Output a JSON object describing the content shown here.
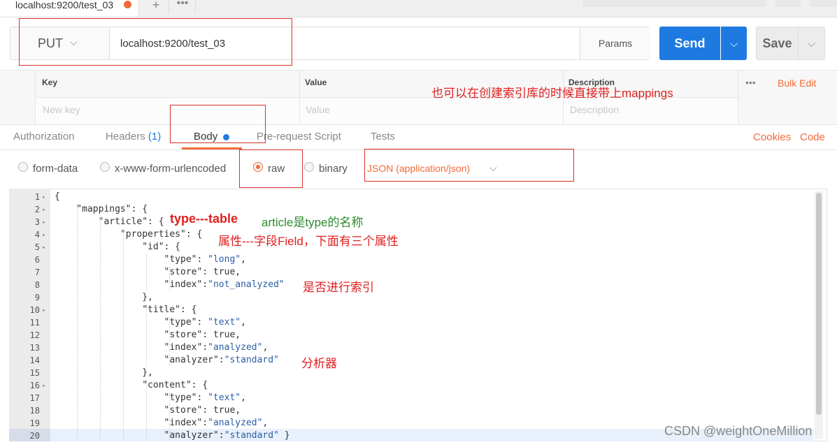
{
  "tabs": {
    "active_title": "localhost:9200/test_03",
    "new_tab": "+",
    "more": "•••"
  },
  "request": {
    "method": "PUT",
    "method_chevron": "⌵",
    "url": "localhost:9200/test_03",
    "params_label": "Params",
    "send_label": "Send",
    "save_label": "Save",
    "dropdown_arrow": "⌵"
  },
  "params_table": {
    "headers": [
      "Key",
      "Value",
      "Description"
    ],
    "placeholders": [
      "New key",
      "Value",
      "Description"
    ],
    "more": "•••",
    "bulk_edit": "Bulk Edit"
  },
  "sub_tabs": {
    "authorization": "Authorization",
    "headers": "Headers",
    "headers_count": "(1)",
    "body": "Body",
    "pre_request": "Pre-request Script",
    "tests": "Tests",
    "cookies": "Cookies",
    "code": "Code"
  },
  "body_types": {
    "options": [
      "form-data",
      "x-www-form-urlencoded",
      "raw",
      "binary"
    ],
    "selected": "raw",
    "content_type": "JSON (application/json)",
    "content_type_chevron": "⌵"
  },
  "editor": {
    "line_numbers": [
      "1",
      "2",
      "3",
      "4",
      "5",
      "6",
      "7",
      "8",
      "9",
      "10",
      "11",
      "12",
      "13",
      "14",
      "15",
      "16",
      "17",
      "18",
      "19",
      "20"
    ],
    "lines": [
      "{",
      "    \"mappings\": {",
      "        \"article\": {",
      "            \"properties\": {",
      "                \"id\": {",
      "                    \"type\": \"long\",",
      "                    \"store\": true,",
      "                    \"index\":\"not_analyzed\"",
      "                },",
      "                \"title\": {",
      "                    \"type\": \"text\",",
      "                    \"store\": true,",
      "                    \"index\":\"analyzed\",",
      "                    \"analyzer\":\"standard\"",
      "                },",
      "                \"content\": {",
      "                    \"type\": \"text\",",
      "                    \"store\": true,",
      "                    \"index\":\"analyzed\",",
      "                    \"analyzer\":\"standard\" }"
    ],
    "fold_marker": "▾"
  },
  "annotations": {
    "mappings_note": "也可以在创建索引库的时候直接带上mappings",
    "type_table": "type---table",
    "article_note": "article是type的名称",
    "properties_note": "属性---字段Field，下面有三个属性",
    "index_note": "是否进行索引",
    "analyzer_note": "分析器"
  },
  "watermark": "CSDN @weightOneMillion",
  "colors": {
    "accent": "#f26b3a",
    "send_blue": "#1e7ae0",
    "annotation_red": "#e02020",
    "annotation_green": "#2e8b2e"
  }
}
